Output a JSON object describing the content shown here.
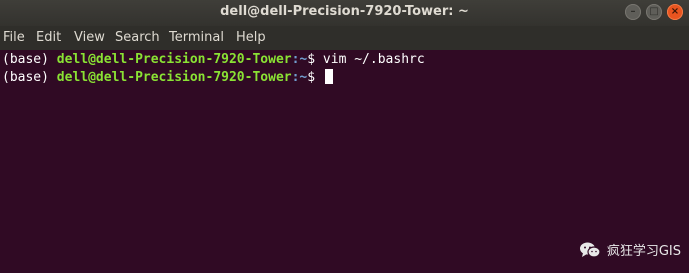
{
  "window": {
    "title": "dell@dell-Precision-7920-Tower: ~",
    "controls": [
      "minimize-icon",
      "maximize-icon",
      "close-icon"
    ]
  },
  "menu": {
    "file": "File",
    "edit": "Edit",
    "view": "View",
    "search": "Search",
    "terminal": "Terminal",
    "help": "Help"
  },
  "terminal": {
    "lines": [
      {
        "env": "(base)",
        "userhost": "dell@dell-Precision-7920-Tower",
        "path": ":~",
        "prompt": "$",
        "command": "vim ~/.bashrc"
      },
      {
        "env": "(base)",
        "userhost": "dell@dell-Precision-7920-Tower",
        "path": ":~",
        "prompt": "$",
        "command": ""
      }
    ]
  },
  "watermark": {
    "text": "疯狂学习GIS",
    "icon": "wechat-icon"
  },
  "colors": {
    "terminal_bg": "#300a24",
    "user_host": "#8ae234",
    "path": "#729fcf",
    "close_button": "#e9541f"
  }
}
